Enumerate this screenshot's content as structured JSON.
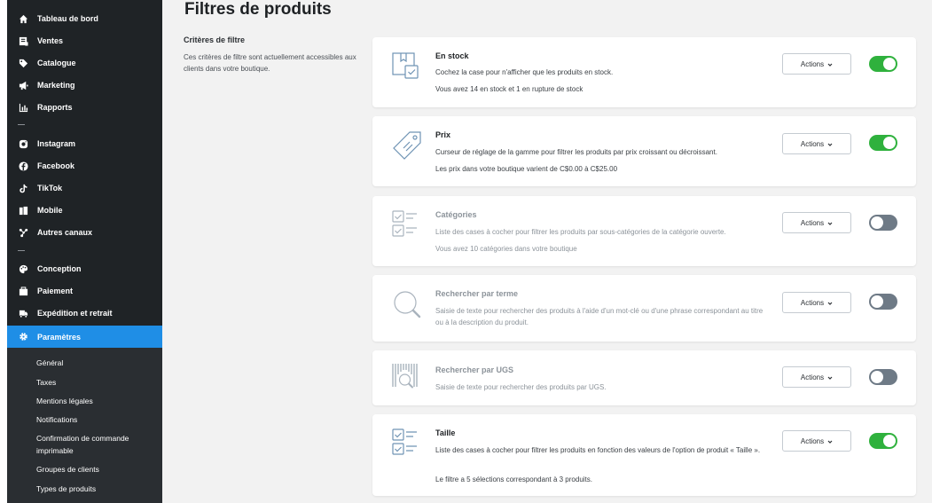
{
  "sidebar": {
    "items": [
      {
        "label": "Tableau de bord",
        "icon": "home-icon"
      },
      {
        "label": "Ventes",
        "icon": "sales-icon"
      },
      {
        "label": "Catalogue",
        "icon": "tag-icon"
      },
      {
        "label": "Marketing",
        "icon": "megaphone-icon"
      },
      {
        "label": "Rapports",
        "icon": "chart-icon"
      },
      {
        "label": "Instagram",
        "icon": "instagram-icon"
      },
      {
        "label": "Facebook",
        "icon": "facebook-icon"
      },
      {
        "label": "TikTok",
        "icon": "tiktok-icon"
      },
      {
        "label": "Mobile",
        "icon": "mobile-icon"
      },
      {
        "label": "Autres canaux",
        "icon": "channels-icon"
      },
      {
        "label": "Conception",
        "icon": "palette-icon"
      },
      {
        "label": "Paiement",
        "icon": "wallet-icon"
      },
      {
        "label": "Expédition et retrait",
        "icon": "truck-icon"
      },
      {
        "label": "Paramètres",
        "icon": "gear-icon"
      }
    ],
    "subitems": [
      "Général",
      "Taxes",
      "Mentions légales",
      "Notifications",
      "Confirmation de commande imprimable",
      "Groupes de clients",
      "Types de produits"
    ],
    "active_color": "#1f8ee6"
  },
  "main": {
    "title": "Filtres de produits",
    "criteria_title": "Critères de filtre",
    "criteria_desc": "Ces critères de filtre sont actuellement accessibles aux clients dans votre boutique.",
    "actions_label": "Actions",
    "filters": [
      {
        "title": "En stock",
        "desc": "Cochez la case pour n'afficher que les produits en stock.",
        "extra": "Vous avez 14 en stock et 1 en rupture de stock",
        "enabled": true
      },
      {
        "title": "Prix",
        "desc": "Curseur de réglage de la gamme pour filtrer les produits par prix croissant ou décroissant.",
        "extra": "Les prix dans votre boutique varient de C$0.00 à C$25.00",
        "enabled": true
      },
      {
        "title": "Catégories",
        "desc": "Liste des cases à cocher pour filtrer les produits par sous-catégories de la catégorie ouverte.",
        "extra": "Vous avez 10 catégories dans votre boutique",
        "enabled": false
      },
      {
        "title": "Rechercher par terme",
        "desc": "Saisie de texte pour rechercher des produits à l'aide d'un mot-clé ou d'une phrase correspondant au titre ou à la description du produit.",
        "extra": "",
        "enabled": false
      },
      {
        "title": "Rechercher par UGS",
        "desc": "Saisie de texte pour rechercher des produits par UGS.",
        "extra": "",
        "enabled": false
      },
      {
        "title": "Taille",
        "desc": "Liste des cases à cocher pour filtrer les produits en fonction des valeurs de l'option de produit « Taille ».",
        "extra": "Le filtre a 5 sélections correspondant à 3 produits.",
        "enabled": true
      }
    ],
    "toggle_on_color": "#2fb13d",
    "toggle_off_color": "#6e7a86"
  }
}
